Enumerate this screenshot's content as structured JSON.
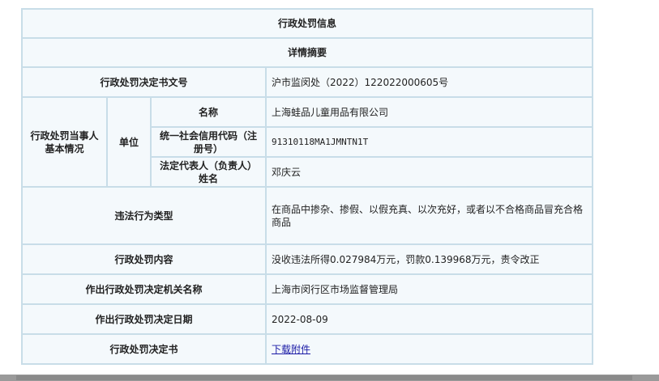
{
  "header": {
    "title": "行政处罚信息",
    "subtitle": "详情摘要"
  },
  "rows": {
    "doc_no_label": "行政处罚决定书文号",
    "doc_no_value": "沪市监闵处（2022）122022000605号",
    "party_label": "行政处罚当事人基本情况",
    "unit_label": "单位",
    "name_label": "名称",
    "name_value": "上海蛙品儿童用品有限公司",
    "credit_label": "统一社会信用代码（注册号）",
    "credit_value": "91310118MA1JMNTN1T",
    "rep_label": "法定代表人（负责人）姓名",
    "rep_value": "邓庆云",
    "violation_label": "违法行为类型",
    "violation_value": "在商品中掺杂、掺假、以假充真、以次充好，或者以不合格商品冒充合格商品",
    "content_label": "行政处罚内容",
    "content_value": "没收违法所得0.027984万元，罚款0.139968万元，责令改正",
    "org_label": "作出行政处罚决定机关名称",
    "org_value": "上海市闵行区市场监督管理局",
    "date_label": "作出行政处罚决定日期",
    "date_value": "2022-08-09",
    "decision_label": "行政处罚决定书",
    "decision_link": "下载附件"
  }
}
